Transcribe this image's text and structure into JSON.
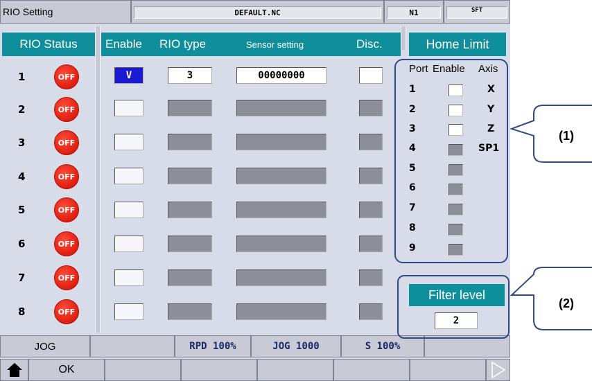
{
  "header": {
    "screen_title": "RIO Setting",
    "file_name": "DEFAULT.NC",
    "line_number": "N1",
    "shift_indicator": "SFT"
  },
  "rio_status": {
    "title": "RIO Status",
    "rows": [
      {
        "num": "1",
        "state": "OFF"
      },
      {
        "num": "2",
        "state": "OFF"
      },
      {
        "num": "3",
        "state": "OFF"
      },
      {
        "num": "4",
        "state": "OFF"
      },
      {
        "num": "5",
        "state": "OFF"
      },
      {
        "num": "6",
        "state": "OFF"
      },
      {
        "num": "7",
        "state": "OFF"
      },
      {
        "num": "8",
        "state": "OFF"
      }
    ]
  },
  "rio_config": {
    "col_enable": "Enable",
    "col_type": "RIO type",
    "col_sensor": "Sensor setting",
    "col_disc": "Disc.",
    "row1": {
      "enable": "V",
      "type": "3",
      "sensor": "00000000"
    }
  },
  "home_limit": {
    "title": "Home Limit",
    "col_port": "Port",
    "col_enable": "Enable",
    "col_axis": "Axis",
    "ports": [
      {
        "port": "1",
        "enabled": true,
        "axis": "X"
      },
      {
        "port": "2",
        "enabled": true,
        "axis": "Y"
      },
      {
        "port": "3",
        "enabled": true,
        "axis": "Z"
      },
      {
        "port": "4",
        "enabled": false,
        "axis": "SP1"
      },
      {
        "port": "5",
        "enabled": false,
        "axis": ""
      },
      {
        "port": "6",
        "enabled": false,
        "axis": ""
      },
      {
        "port": "7",
        "enabled": false,
        "axis": ""
      },
      {
        "port": "8",
        "enabled": false,
        "axis": ""
      },
      {
        "port": "9",
        "enabled": false,
        "axis": ""
      }
    ]
  },
  "filter": {
    "title": "Filter level",
    "value": "2"
  },
  "status_bar": {
    "mode": "JOG",
    "rapid": "RPD 100%",
    "jog_speed": "JOG 1000",
    "spindle": "S 100%"
  },
  "function_keys": {
    "ok_label": "OK"
  },
  "callouts": {
    "one": "(1)",
    "two": "(2)"
  },
  "colors": {
    "header_teal": "#0f8f9b",
    "off_red": "#e01e10",
    "selected_blue": "#1a1ad0",
    "callout_blue": "#2f4a86"
  }
}
